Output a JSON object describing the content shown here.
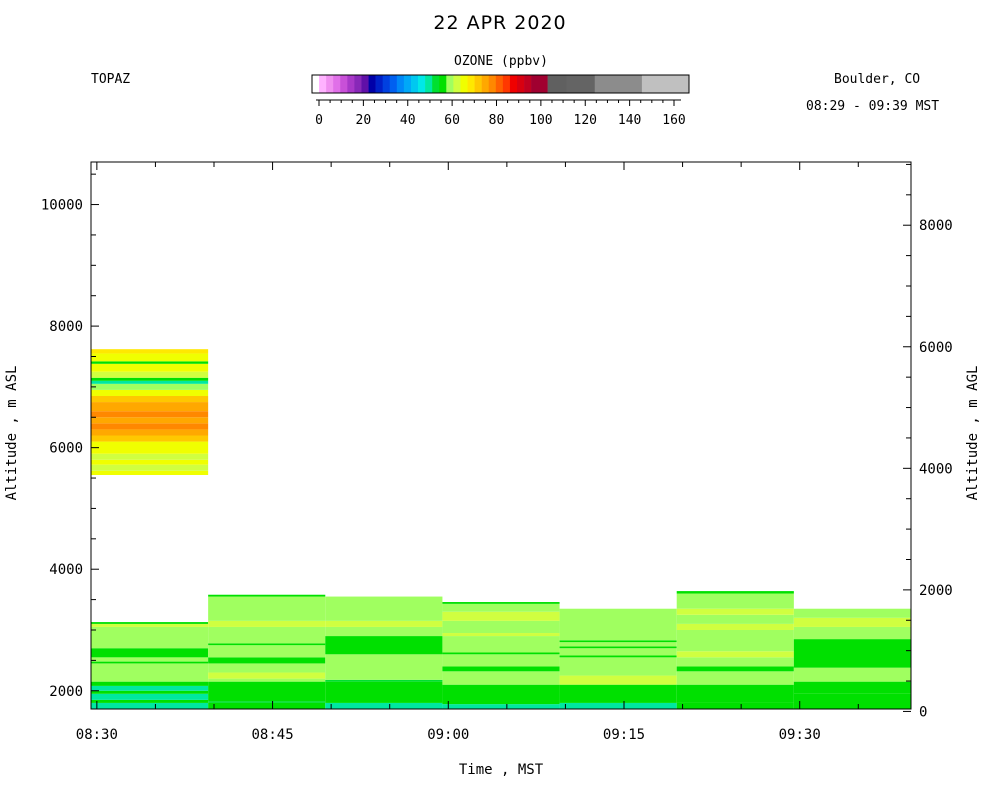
{
  "chart_data": {
    "type": "heatmap",
    "title": "22 APR 2020",
    "instrument": "TOPAZ",
    "location": "Boulder, CO",
    "time_range": "08:29 - 09:39 MST",
    "xlabel": "Time , MST",
    "ylabel_left": "Altitude , m ASL",
    "ylabel_right": "Altitude , m AGL",
    "x_ticks": [
      "08:30",
      "08:45",
      "09:00",
      "09:15",
      "09:30"
    ],
    "x_tick_minutes": [
      510,
      525,
      540,
      555,
      570
    ],
    "xlim_minutes": [
      509.5,
      579.5
    ],
    "ylim_left": [
      1700,
      10700
    ],
    "y_ticks_left": [
      2000,
      4000,
      6000,
      8000,
      10000
    ],
    "y_ticks_right": [
      0,
      2000,
      4000,
      6000,
      8000
    ],
    "ground_offset_m": 1660,
    "colorbar": {
      "label": "OZONE (ppbv)",
      "ticks": [
        0,
        20,
        40,
        60,
        80,
        100,
        120,
        140,
        160
      ],
      "colors": [
        {
          "from": 0,
          "to": 3,
          "color": "#ffffff"
        },
        {
          "from": 3,
          "to": 6,
          "color": "#ffb3ff"
        },
        {
          "from": 6,
          "to": 9,
          "color": "#f090f0"
        },
        {
          "from": 9,
          "to": 12,
          "color": "#e070e8"
        },
        {
          "from": 12,
          "to": 15,
          "color": "#c850d8"
        },
        {
          "from": 15,
          "to": 18,
          "color": "#a838c8"
        },
        {
          "from": 18,
          "to": 21,
          "color": "#8828b8"
        },
        {
          "from": 21,
          "to": 24,
          "color": "#6010a8"
        },
        {
          "from": 24,
          "to": 27,
          "color": "#0000a8"
        },
        {
          "from": 27,
          "to": 30,
          "color": "#0020c8"
        },
        {
          "from": 30,
          "to": 33,
          "color": "#0040e0"
        },
        {
          "from": 33,
          "to": 36,
          "color": "#0060f0"
        },
        {
          "from": 36,
          "to": 39,
          "color": "#0088f8"
        },
        {
          "from": 39,
          "to": 42,
          "color": "#00a8f8"
        },
        {
          "from": 42,
          "to": 45,
          "color": "#00c8f0"
        },
        {
          "from": 45,
          "to": 48,
          "color": "#00e8e8"
        },
        {
          "from": 48,
          "to": 51,
          "color": "#00e8a0"
        },
        {
          "from": 51,
          "to": 54,
          "color": "#00e030"
        },
        {
          "from": 54,
          "to": 57,
          "color": "#00e000"
        },
        {
          "from": 57,
          "to": 60,
          "color": "#a0ff60"
        },
        {
          "from": 60,
          "to": 63,
          "color": "#d0ff40"
        },
        {
          "from": 63,
          "to": 66,
          "color": "#f0ff00"
        },
        {
          "from": 66,
          "to": 69,
          "color": "#ffe800"
        },
        {
          "from": 69,
          "to": 72,
          "color": "#ffc800"
        },
        {
          "from": 72,
          "to": 75,
          "color": "#ffa800"
        },
        {
          "from": 75,
          "to": 78,
          "color": "#ff8800"
        },
        {
          "from": 78,
          "to": 81,
          "color": "#ff6000"
        },
        {
          "from": 81,
          "to": 84,
          "color": "#ff3800"
        },
        {
          "from": 84,
          "to": 87,
          "color": "#f00000"
        },
        {
          "from": 87,
          "to": 90,
          "color": "#d80010"
        },
        {
          "from": 90,
          "to": 93,
          "color": "#c00020"
        },
        {
          "from": 93,
          "to": 100,
          "color": "#a00030"
        },
        {
          "from": 100,
          "to": 108,
          "color": "#606060"
        },
        {
          "from": 108,
          "to": 120,
          "color": "#646464"
        },
        {
          "from": 120,
          "to": 140,
          "color": "#8c8c8c"
        },
        {
          "from": 140,
          "to": 160,
          "color": "#c0c0c0"
        }
      ]
    },
    "profiles": [
      {
        "t_start": 509.5,
        "t_end": 519.5,
        "layers": [
          {
            "z0": 5550,
            "z1": 5620,
            "v": 65
          },
          {
            "z0": 5620,
            "z1": 5720,
            "v": 62
          },
          {
            "z0": 5720,
            "z1": 5800,
            "v": 65
          },
          {
            "z0": 5800,
            "z1": 5900,
            "v": 62
          },
          {
            "z0": 5900,
            "z1": 6100,
            "v": 65
          },
          {
            "z0": 6100,
            "z1": 6200,
            "v": 71
          },
          {
            "z0": 6200,
            "z1": 6300,
            "v": 74
          },
          {
            "z0": 6300,
            "z1": 6400,
            "v": 76
          },
          {
            "z0": 6400,
            "z1": 6500,
            "v": 74
          },
          {
            "z0": 6500,
            "z1": 6600,
            "v": 76
          },
          {
            "z0": 6600,
            "z1": 6750,
            "v": 72
          },
          {
            "z0": 6750,
            "z1": 6850,
            "v": 70
          },
          {
            "z0": 6850,
            "z1": 6950,
            "v": 65
          },
          {
            "z0": 6950,
            "z1": 7050,
            "v": 58
          },
          {
            "z0": 7050,
            "z1": 7100,
            "v": 50
          },
          {
            "z0": 7100,
            "z1": 7150,
            "v": 55
          },
          {
            "z0": 7150,
            "z1": 7250,
            "v": 62
          },
          {
            "z0": 7250,
            "z1": 7380,
            "v": 64
          },
          {
            "z0": 7380,
            "z1": 7420,
            "v": 55
          },
          {
            "z0": 7420,
            "z1": 7550,
            "v": 65
          },
          {
            "z0": 7550,
            "z1": 7620,
            "v": 67
          },
          {
            "z0": 1700,
            "z1": 1800,
            "v": 50
          },
          {
            "z0": 1800,
            "z1": 1850,
            "v": 54
          },
          {
            "z0": 1850,
            "z1": 1950,
            "v": 50
          },
          {
            "z0": 1950,
            "z1": 2000,
            "v": 54
          },
          {
            "z0": 2000,
            "z1": 2080,
            "v": 50
          },
          {
            "z0": 2080,
            "z1": 2150,
            "v": 55
          },
          {
            "z0": 2150,
            "z1": 2450,
            "v": 58
          },
          {
            "z0": 2450,
            "z1": 2480,
            "v": 55
          },
          {
            "z0": 2480,
            "z1": 2550,
            "v": 58
          },
          {
            "z0": 2550,
            "z1": 2700,
            "v": 55
          },
          {
            "z0": 2700,
            "z1": 3050,
            "v": 58
          },
          {
            "z0": 3050,
            "z1": 3100,
            "v": 61
          },
          {
            "z0": 3100,
            "z1": 3130,
            "v": 55
          }
        ]
      },
      {
        "t_start": 519.5,
        "t_end": 529.5,
        "layers": [
          {
            "z0": 1700,
            "z1": 1800,
            "v": 54
          },
          {
            "z0": 1800,
            "z1": 1830,
            "v": 52
          },
          {
            "z0": 1830,
            "z1": 2150,
            "v": 55
          },
          {
            "z0": 2150,
            "z1": 2200,
            "v": 58
          },
          {
            "z0": 2200,
            "z1": 2300,
            "v": 62
          },
          {
            "z0": 2300,
            "z1": 2450,
            "v": 58
          },
          {
            "z0": 2450,
            "z1": 2550,
            "v": 55
          },
          {
            "z0": 2550,
            "z1": 2750,
            "v": 58
          },
          {
            "z0": 2750,
            "z1": 2780,
            "v": 55
          },
          {
            "z0": 2780,
            "z1": 3050,
            "v": 58
          },
          {
            "z0": 3050,
            "z1": 3150,
            "v": 61
          },
          {
            "z0": 3150,
            "z1": 3550,
            "v": 58
          },
          {
            "z0": 3550,
            "z1": 3580,
            "v": 55
          }
        ]
      },
      {
        "t_start": 529.5,
        "t_end": 539.5,
        "layers": [
          {
            "z0": 1700,
            "z1": 1800,
            "v": 50
          },
          {
            "z0": 1800,
            "z1": 2150,
            "v": 55
          },
          {
            "z0": 2150,
            "z1": 2180,
            "v": 52
          },
          {
            "z0": 2180,
            "z1": 2600,
            "v": 58
          },
          {
            "z0": 2600,
            "z1": 2900,
            "v": 55
          },
          {
            "z0": 2900,
            "z1": 3050,
            "v": 58
          },
          {
            "z0": 3050,
            "z1": 3150,
            "v": 61
          },
          {
            "z0": 3150,
            "z1": 3550,
            "v": 58
          }
        ]
      },
      {
        "t_start": 539.5,
        "t_end": 549.5,
        "layers": [
          {
            "z0": 1700,
            "z1": 1780,
            "v": 50
          },
          {
            "z0": 1780,
            "z1": 2100,
            "v": 55
          },
          {
            "z0": 2100,
            "z1": 2320,
            "v": 58
          },
          {
            "z0": 2320,
            "z1": 2400,
            "v": 55
          },
          {
            "z0": 2400,
            "z1": 2600,
            "v": 58
          },
          {
            "z0": 2600,
            "z1": 2630,
            "v": 55
          },
          {
            "z0": 2630,
            "z1": 2900,
            "v": 58
          },
          {
            "z0": 2900,
            "z1": 2950,
            "v": 61
          },
          {
            "z0": 2950,
            "z1": 3150,
            "v": 58
          },
          {
            "z0": 3150,
            "z1": 3300,
            "v": 62
          },
          {
            "z0": 3300,
            "z1": 3430,
            "v": 58
          },
          {
            "z0": 3430,
            "z1": 3460,
            "v": 55
          }
        ]
      },
      {
        "t_start": 549.5,
        "t_end": 559.5,
        "layers": [
          {
            "z0": 1700,
            "z1": 1800,
            "v": 50
          },
          {
            "z0": 1800,
            "z1": 2100,
            "v": 55
          },
          {
            "z0": 2100,
            "z1": 2250,
            "v": 62
          },
          {
            "z0": 2250,
            "z1": 2550,
            "v": 58
          },
          {
            "z0": 2550,
            "z1": 2580,
            "v": 55
          },
          {
            "z0": 2580,
            "z1": 2700,
            "v": 58
          },
          {
            "z0": 2700,
            "z1": 2730,
            "v": 55
          },
          {
            "z0": 2730,
            "z1": 2800,
            "v": 58
          },
          {
            "z0": 2800,
            "z1": 2830,
            "v": 55
          },
          {
            "z0": 2830,
            "z1": 3350,
            "v": 58
          }
        ]
      },
      {
        "t_start": 559.5,
        "t_end": 569.5,
        "layers": [
          {
            "z0": 1700,
            "z1": 1800,
            "v": 54
          },
          {
            "z0": 1800,
            "z1": 2100,
            "v": 55
          },
          {
            "z0": 2100,
            "z1": 2320,
            "v": 58
          },
          {
            "z0": 2320,
            "z1": 2400,
            "v": 55
          },
          {
            "z0": 2400,
            "z1": 2550,
            "v": 58
          },
          {
            "z0": 2550,
            "z1": 2650,
            "v": 62
          },
          {
            "z0": 2650,
            "z1": 3000,
            "v": 58
          },
          {
            "z0": 3000,
            "z1": 3100,
            "v": 62
          },
          {
            "z0": 3100,
            "z1": 3250,
            "v": 58
          },
          {
            "z0": 3250,
            "z1": 3350,
            "v": 62
          },
          {
            "z0": 3350,
            "z1": 3600,
            "v": 58
          },
          {
            "z0": 3600,
            "z1": 3640,
            "v": 55
          }
        ]
      },
      {
        "t_start": 569.5,
        "t_end": 579.5,
        "layers": [
          {
            "z0": 1700,
            "z1": 1950,
            "v": 55
          },
          {
            "z0": 1950,
            "z1": 2150,
            "v": 55
          },
          {
            "z0": 2150,
            "z1": 2380,
            "v": 58
          },
          {
            "z0": 2380,
            "z1": 2850,
            "v": 55
          },
          {
            "z0": 2850,
            "z1": 3050,
            "v": 58
          },
          {
            "z0": 3050,
            "z1": 3200,
            "v": 62
          },
          {
            "z0": 3200,
            "z1": 3350,
            "v": 58
          }
        ]
      }
    ]
  }
}
